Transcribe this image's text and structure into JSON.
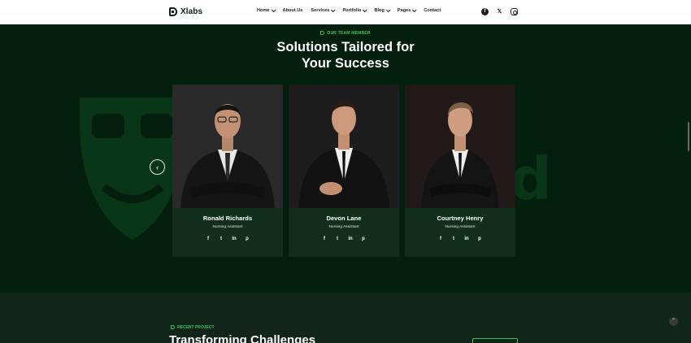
{
  "header": {
    "logo_text": "Xlabs",
    "nav": [
      {
        "label": "Home",
        "dropdown": true
      },
      {
        "label": "About Us",
        "dropdown": false
      },
      {
        "label": "Services",
        "dropdown": true
      },
      {
        "label": "Portfolio",
        "dropdown": true
      },
      {
        "label": "Blog",
        "dropdown": true
      },
      {
        "label": "Pages",
        "dropdown": true
      },
      {
        "label": "Contact",
        "dropdown": false
      }
    ],
    "social_icons": [
      "facebook-icon",
      "x-icon",
      "instagram-icon"
    ]
  },
  "team": {
    "eyebrow": "OUR TEAM MEMBER",
    "title_line1": "Solutions Tailored for",
    "title_line2": "Your Success",
    "watermark": "bid",
    "members": [
      {
        "name": "Ronald Richards",
        "role": "Nursing Assistant"
      },
      {
        "name": "Devon Lane",
        "role": "Nursing Assistant"
      },
      {
        "name": "Courtney Henry",
        "role": "Nursing Assistant"
      }
    ],
    "member_social_icons": [
      "facebook-icon",
      "twitter-icon",
      "linkedin-icon",
      "pinterest-icon"
    ],
    "prev_arrow": "‹"
  },
  "projects": {
    "eyebrow": "RECENT PROJECT",
    "title": "Transforming Challenges"
  },
  "colors": {
    "accent": "#3fbf5f",
    "background": "#03200f",
    "card_info": "#10301c"
  }
}
